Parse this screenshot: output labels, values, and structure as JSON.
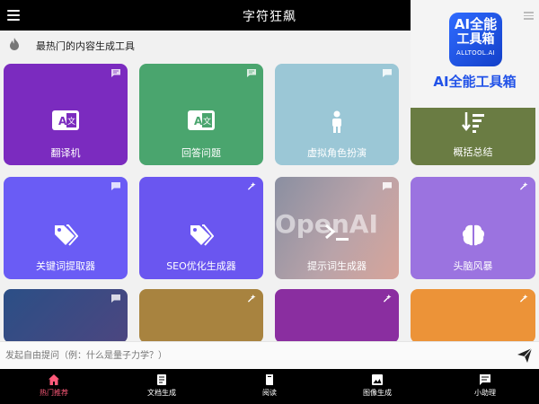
{
  "app": {
    "title": "字符狂飙"
  },
  "logo": {
    "line1": "AI全能",
    "line2": "工具箱",
    "line3": "ALLTOOL.AI",
    "caption": "AI全能工具箱"
  },
  "section": {
    "title": "最热门的内容生成工具"
  },
  "cards": [
    {
      "label": "翻译机",
      "icon": "translate-icon",
      "corner": "chat-icon"
    },
    {
      "label": "回答问题",
      "icon": "translate-icon",
      "corner": "chat-icon"
    },
    {
      "label": "虚拟角色扮演",
      "icon": "person-icon",
      "corner": "chat-icon"
    },
    {
      "label": "概括总结",
      "icon": "sort-icon",
      "corner": ""
    },
    {
      "label": "关键词提取器",
      "icon": "tags-icon",
      "corner": "chat-icon"
    },
    {
      "label": "SEO优化生成器",
      "icon": "tags-icon",
      "corner": "magic-icon"
    },
    {
      "label": "提示词生成器",
      "icon": "terminal-icon",
      "corner": "chat-icon"
    },
    {
      "label": "头脑风暴",
      "icon": "brain-icon",
      "corner": "magic-icon"
    },
    {
      "label": "",
      "icon": "",
      "corner": "chat-icon"
    },
    {
      "label": "",
      "icon": "",
      "corner": "magic-icon"
    },
    {
      "label": "",
      "icon": "",
      "corner": "magic-icon"
    },
    {
      "label": "",
      "icon": "",
      "corner": "magic-icon"
    }
  ],
  "watermark": "OpenAI",
  "input": {
    "placeholder": "发起自由提问（例：什么是量子力学？）"
  },
  "nav": [
    {
      "label": "热门推荐",
      "icon": "home-icon",
      "active": true
    },
    {
      "label": "文档生成",
      "icon": "document-icon",
      "active": false
    },
    {
      "label": "阅读",
      "icon": "book-icon",
      "active": false
    },
    {
      "label": "图像生成",
      "icon": "image-icon",
      "active": false
    },
    {
      "label": "小助理",
      "icon": "chat-icon",
      "active": false
    }
  ],
  "colors": {
    "active_nav": "#ff5a7a",
    "logo_blue": "#2152e8"
  }
}
